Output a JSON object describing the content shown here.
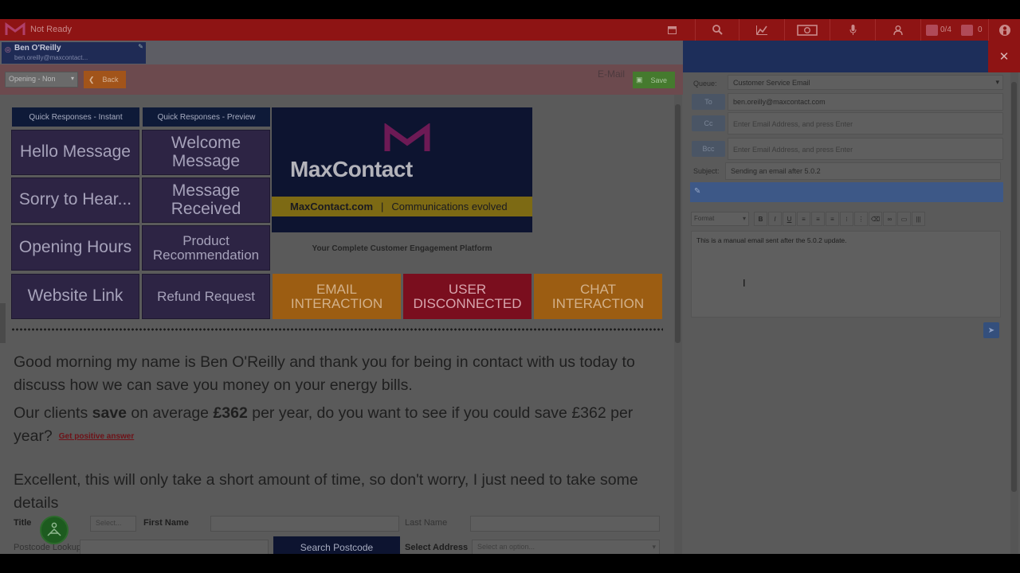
{
  "topbar": {
    "status": "Not Ready",
    "icons": [
      "window-icon",
      "search-icon",
      "chart-icon",
      "money-icon",
      "microphone-icon",
      "user-icon"
    ],
    "agents_count": "0/4",
    "alerts_count": "0"
  },
  "agent": {
    "name": "Ben O'Reilly",
    "email": "ben.oreilly@maxcontact..."
  },
  "actionbar": {
    "select_value": "Opening - Non",
    "back_label": "Back",
    "channel_label": "E-Mail",
    "save_label": "Save"
  },
  "quick_responses": {
    "instant_header": "Quick Responses - Instant",
    "preview_header": "Quick Responses - Preview",
    "instant": [
      "Hello Message",
      "Sorry to Hear...",
      "Opening Hours",
      "Website Link"
    ],
    "preview": [
      "Welcome Message",
      "Message Received",
      "Product Recommendation",
      "Refund Request"
    ]
  },
  "brand": {
    "wordmark": "MaxContact",
    "url": "MaxContact.com",
    "separator": "|",
    "slogan": "Communications evolved",
    "tagline": "Your Complete Customer Engagement Platform"
  },
  "status_buttons": {
    "email": "EMAIL INTERACTION",
    "disconnected": "USER DISCONNECTED",
    "chat": "CHAT INTERACTION"
  },
  "script": {
    "greeting": "Good morning my name is Ben O'Reilly and thank you for being in contact with us today to discuss how we can save you money on your energy bills.",
    "pitch_a": "Our clients ",
    "pitch_b": "save",
    "pitch_c": " on average ",
    "pitch_d": "£362",
    "pitch_e": " per year, do you want to see if you could save £362 per year?",
    "link": "Get positive answer",
    "followup": "Excellent, this will only take a short amount of time, so don't worry, I just need to take some details"
  },
  "form": {
    "title_label": "Title",
    "title_value": "Select...",
    "first_name_label": "First Name",
    "last_name_label": "Last Name",
    "postcode_label": "Postcode Lookup",
    "search_button": "Search Postcode",
    "address_label": "Select Address",
    "address_placeholder": "Select an option..."
  },
  "email": {
    "queue_label": "Queue:",
    "queue_value": "Customer Service Email",
    "to_label": "To",
    "to_value": "ben.oreilly@maxcontact.com",
    "cc_label": "Cc",
    "cc_placeholder": "Enter Email Address, and press Enter",
    "bcc_label": "Bcc",
    "bcc_placeholder": "Enter Email Address, and press Enter",
    "subject_label": "Subject:",
    "subject_value": "Sending an email after 5.0.2",
    "format_label": "Format",
    "body": "This is a manual email sent after the 5.0.2 update."
  }
}
